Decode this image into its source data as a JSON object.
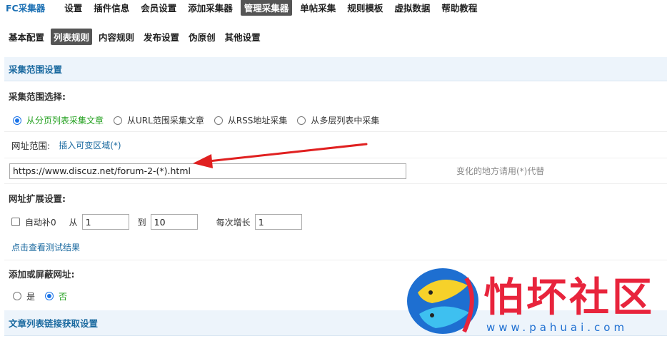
{
  "topnav": {
    "brand": "FC采集器",
    "items": [
      "设置",
      "插件信息",
      "会员设置",
      "添加采集器",
      "管理采集器",
      "单帖采集",
      "规则模板",
      "虚拟数据",
      "帮助教程"
    ],
    "active_index": 4
  },
  "subnav": {
    "items": [
      "基本配置",
      "列表规则",
      "内容规则",
      "发布设置",
      "伪原创",
      "其他设置"
    ],
    "active_index": 1
  },
  "section1": {
    "title": "采集范围设置"
  },
  "range_select": {
    "label": "采集范围选择:",
    "options": [
      "从分页列表采集文章",
      "从URL范围采集文章",
      "从RSS地址采集",
      "从多层列表中采集"
    ],
    "selected_index": 0
  },
  "url_range": {
    "label": "网址范围:",
    "insert_link": "插入可变区域(*)",
    "value": "https://www.discuz.net/forum-2-(*).html",
    "hint": "变化的地方请用(*)代替"
  },
  "url_expand": {
    "label": "网址扩展设置:",
    "autofill_label": "自动补0",
    "from_label": "从",
    "from_value": "1",
    "to_label": "到",
    "to_value": "10",
    "step_label": "每次增长",
    "step_value": "1",
    "test_link": "点击查看测试结果"
  },
  "add_block": {
    "label": "添加或屏蔽网址:",
    "yes": "是",
    "no": "否",
    "selected": "no"
  },
  "section2": {
    "title": "文章列表链接获取设置"
  },
  "watermark": {
    "text": "怕坏社区",
    "url": "www.pahuai.com"
  },
  "colors": {
    "accent_blue": "#1b6aa0",
    "selected_green": "#23a01f",
    "arrow_red": "#e02020",
    "section_bg": "#edf4fb"
  }
}
